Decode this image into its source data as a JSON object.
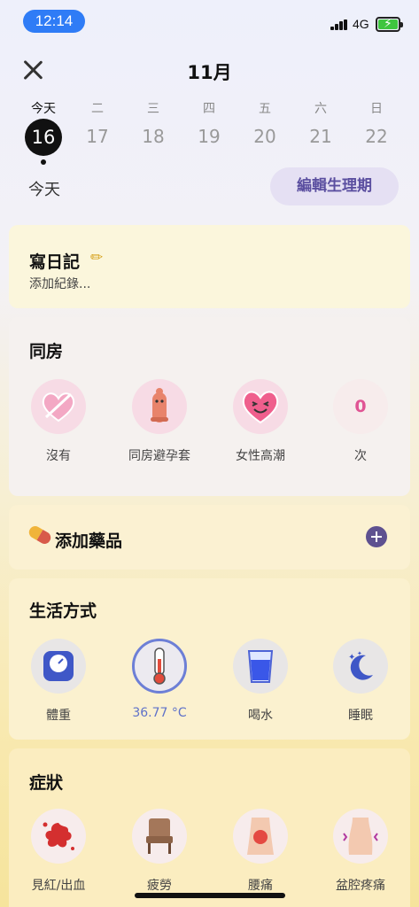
{
  "status": {
    "time": "12:14",
    "network": "4G"
  },
  "header": {
    "month": "11月"
  },
  "week": [
    {
      "label": "今天",
      "num": "16"
    },
    {
      "label": "二",
      "num": "17"
    },
    {
      "label": "三",
      "num": "18"
    },
    {
      "label": "四",
      "num": "19"
    },
    {
      "label": "五",
      "num": "20"
    },
    {
      "label": "六",
      "num": "21"
    },
    {
      "label": "日",
      "num": "22"
    }
  ],
  "today_label": "今天",
  "edit_period_label": "編輯生理期",
  "diary": {
    "title": "寫日記",
    "placeholder": "添加紀錄..."
  },
  "intercourse": {
    "title": "同房",
    "options": [
      {
        "label": "沒有",
        "icon": "crossed-heart-icon"
      },
      {
        "label": "同房避孕套",
        "icon": "condom-icon"
      },
      {
        "label": "女性高潮",
        "icon": "smiling-heart-icon"
      },
      {
        "label": "次",
        "value": "0"
      }
    ]
  },
  "medicine": {
    "title": "添加藥品"
  },
  "lifestyle": {
    "title": "生活方式",
    "options": [
      {
        "label": "體重",
        "icon": "scale-icon"
      },
      {
        "label": "36.77 °C",
        "icon": "thermometer-icon"
      },
      {
        "label": "喝水",
        "icon": "water-glass-icon"
      },
      {
        "label": "睡眠",
        "icon": "moon-icon"
      }
    ]
  },
  "symptoms": {
    "title": "症狀",
    "options": [
      {
        "label": "見紅/出血",
        "icon": "blood-splash-icon"
      },
      {
        "label": "疲勞",
        "icon": "chair-icon"
      },
      {
        "label": "腰痛",
        "icon": "back-pain-icon"
      },
      {
        "label": "盆腔疼痛",
        "icon": "pelvic-pain-icon"
      }
    ]
  },
  "colors": {
    "accent": "#5e5190",
    "today": "#111111",
    "temp": "#5f72c9",
    "count": "#e05494"
  }
}
